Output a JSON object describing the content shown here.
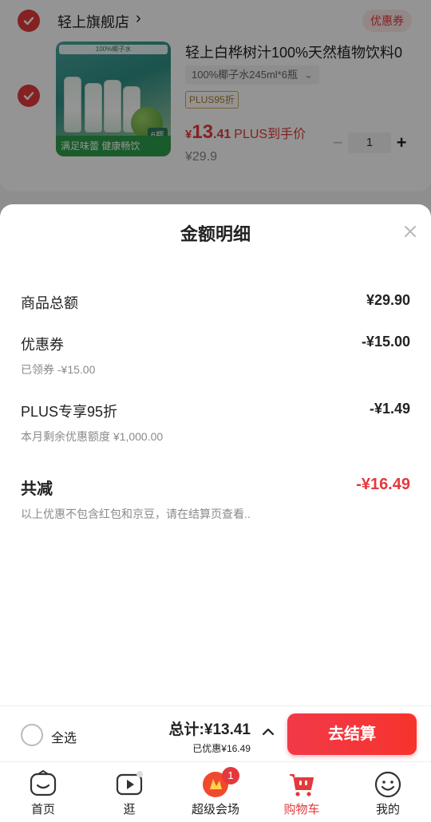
{
  "cart": {
    "store_name": "轻上旗舰店",
    "coupon_button": "优惠券",
    "product": {
      "title": "轻上白桦树汁100%天然植物饮料0",
      "spec": "100%椰子水245ml*6瓶",
      "plus_tag": "PLUS95折",
      "price_symbol": "¥",
      "price_int": "13",
      "price_dec": ".41",
      "price_suffix": "PLUS到手价",
      "original_price": "¥29.9",
      "quantity": "1",
      "image_banner": "满足味蕾 健康畅饮",
      "image_badge": "6瓶",
      "image_top": "100%椰子水"
    }
  },
  "sheet": {
    "title": "金额明细",
    "rows": [
      {
        "label": "商品总额",
        "value": "¥29.90",
        "sub": ""
      },
      {
        "label": "优惠券",
        "value": "-¥15.00",
        "sub": "已领券 -¥15.00"
      },
      {
        "label": "PLUS专享95折",
        "value": "-¥1.49",
        "sub": "本月剩余优惠额度 ¥1,000.00"
      }
    ],
    "total_label": "共减",
    "total_value": "-¥16.49",
    "note": "以上优惠不包含红包和京豆，请在结算页查看.."
  },
  "checkout": {
    "select_all": "全选",
    "total_text": "总计:¥13.41",
    "discount_text": "已优惠¥16.49",
    "button": "去结算"
  },
  "tabs": [
    {
      "label": "首页",
      "icon": "home-icon"
    },
    {
      "label": "逛",
      "icon": "play-icon"
    },
    {
      "label": "超级会场",
      "icon": "venue-icon",
      "badge": "1"
    },
    {
      "label": "购物车",
      "icon": "cart-icon"
    },
    {
      "label": "我的",
      "icon": "profile-icon"
    }
  ],
  "colors": {
    "accent": "#e4393c",
    "gray_text": "#8a8a8a"
  }
}
